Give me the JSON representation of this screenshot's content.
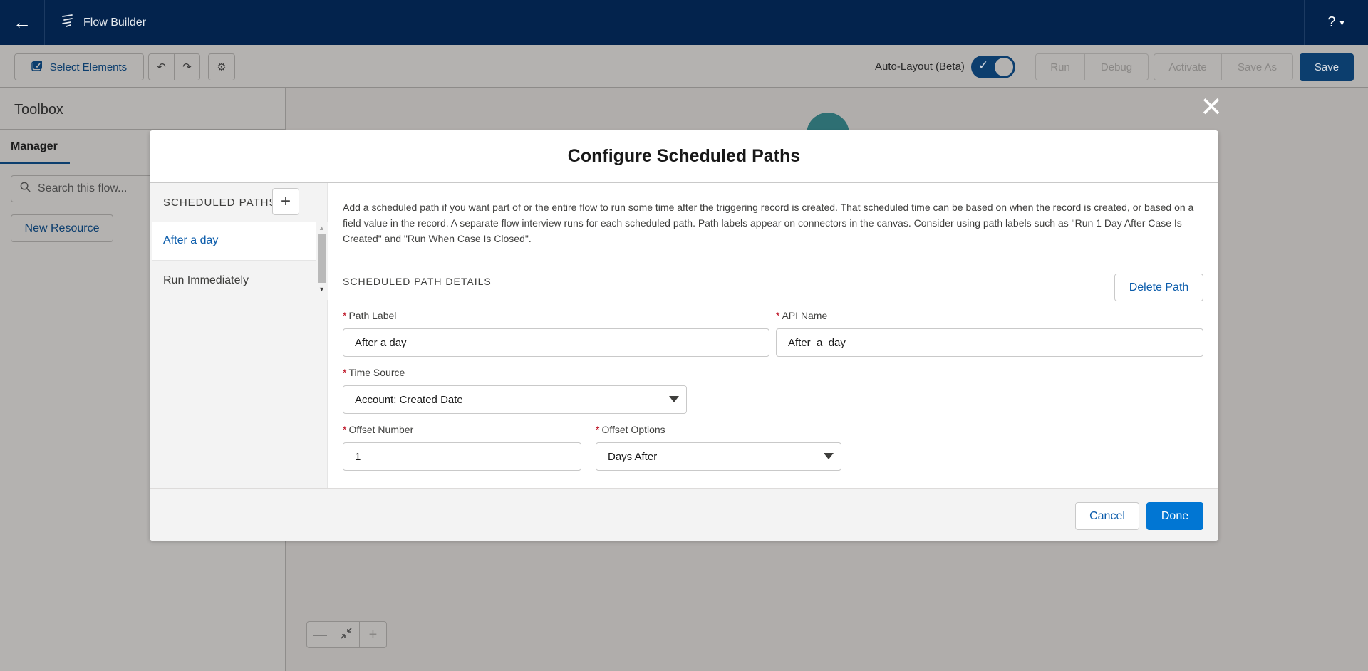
{
  "topbar": {
    "back_icon": "arrow-left-icon",
    "app_icon": "flow-icon",
    "app_name": "Flow Builder",
    "help_label": "?",
    "help_caret": "▾"
  },
  "toolbar": {
    "select_elements_label": "Select Elements",
    "auto_layout_label": "Auto-Layout (Beta)",
    "auto_layout_on": true,
    "run_label": "Run",
    "debug_label": "Debug",
    "activate_label": "Activate",
    "save_as_label": "Save As",
    "save_label": "Save"
  },
  "toolbox": {
    "title": "Toolbox",
    "tab_label": "Manager",
    "search_placeholder": "Search this flow...",
    "new_resource_label": "New Resource"
  },
  "canvas": {
    "zoom_out_label": "—",
    "fit_icon": "fit-view-icon",
    "zoom_in_label": "+"
  },
  "modal": {
    "title": "Configure Scheduled Paths",
    "paths_header": "SCHEDULED PATHS",
    "add_path_label": "+",
    "paths": [
      {
        "label": "After a day",
        "selected": true
      },
      {
        "label": "Run Immediately",
        "selected": false
      }
    ],
    "description": "Add a scheduled path if you want part of or the entire flow to run some time after the triggering record is created. That scheduled time can be based on when the record is created, or based on a field value in the record. A separate flow interview runs for each scheduled path. Path labels appear on connectors in the canvas. Consider using path labels such as \"Run 1 Day After Case Is Created\" and \"Run When Case Is Closed\".",
    "details_title": "SCHEDULED PATH DETAILS",
    "delete_path_label": "Delete Path",
    "fields": {
      "path_label": {
        "label": "Path Label",
        "value": "After a day",
        "required": "*"
      },
      "api_name": {
        "label": "API Name",
        "value": "After_a_day",
        "required": "*"
      },
      "time_source": {
        "label": "Time Source",
        "value": "Account: Created Date",
        "required": "*"
      },
      "offset_number": {
        "label": "Offset Number",
        "value": "1",
        "required": "*"
      },
      "offset_options": {
        "label": "Offset Options",
        "value": "Days After",
        "required": "*"
      }
    },
    "cancel_label": "Cancel",
    "done_label": "Done",
    "close_label": "✕"
  },
  "colors": {
    "brand_navy": "#03234d",
    "primary_blue": "#0176d3",
    "link_blue": "#0b5cab",
    "required_red": "#ba0517"
  }
}
